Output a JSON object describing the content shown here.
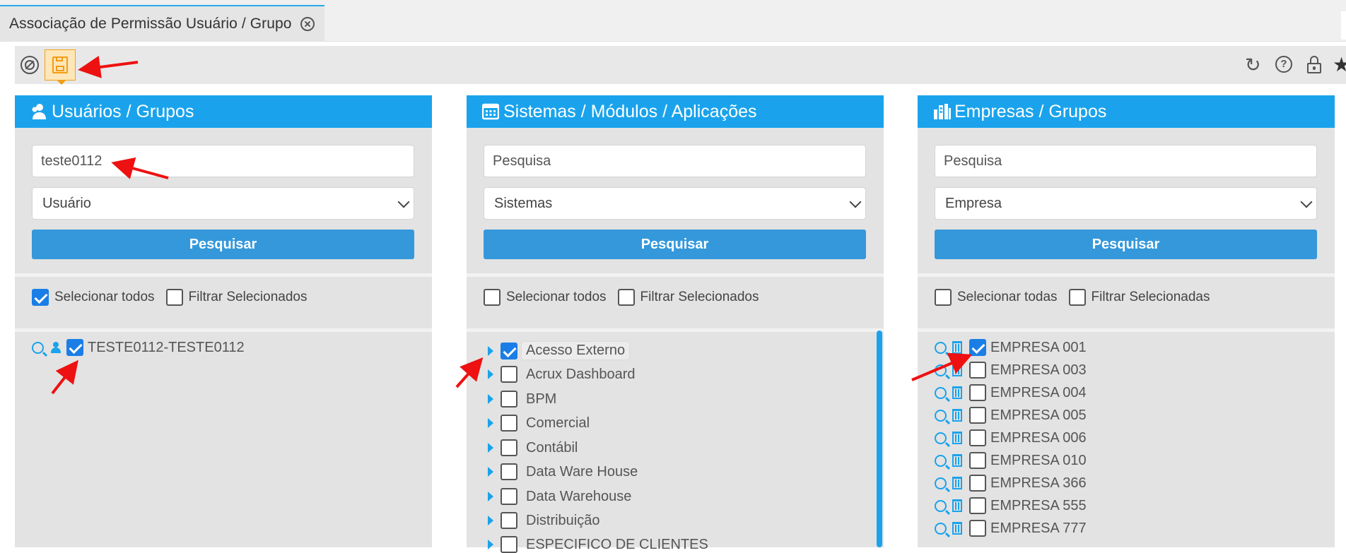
{
  "tab": {
    "title": "Associação de Permissão Usuário / Grupo"
  },
  "toolbar": {
    "left_icons": [
      "cancel-icon",
      "save-icon"
    ],
    "right_icons": [
      "refresh-icon",
      "help-icon",
      "lock-icon",
      "star-icon"
    ]
  },
  "panels": [
    {
      "title": "Usuários / Grupos",
      "icon": "user-group-icon",
      "search_value": "teste0112",
      "search_placeholder": "",
      "select_value": "Usuário",
      "button_label": "Pesquisar",
      "select_all_label": "Selecionar todos",
      "select_all_checked": true,
      "filter_label": "Filtrar Selecionados",
      "filter_checked": false,
      "items": [
        {
          "label": "TESTE0112-TESTE0112",
          "checked": true
        }
      ]
    },
    {
      "title": "Sistemas / Módulos / Aplicações",
      "icon": "calendar-grid-icon",
      "search_value": "",
      "search_placeholder": "Pesquisa",
      "select_value": "Sistemas",
      "button_label": "Pesquisar",
      "select_all_label": "Selecionar todos",
      "select_all_checked": false,
      "filter_label": "Filtrar Selecionados",
      "filter_checked": false,
      "items": [
        {
          "label": "Acesso Externo",
          "checked": true
        },
        {
          "label": "Acrux Dashboard",
          "checked": false
        },
        {
          "label": "BPM",
          "checked": false
        },
        {
          "label": "Comercial",
          "checked": false
        },
        {
          "label": "Contábil",
          "checked": false
        },
        {
          "label": "Data Ware House",
          "checked": false
        },
        {
          "label": "Data Warehouse",
          "checked": false
        },
        {
          "label": "Distribuição",
          "checked": false
        },
        {
          "label": "ESPECIFICO DE CLIENTES",
          "checked": false
        }
      ]
    },
    {
      "title": "Empresas / Grupos",
      "icon": "buildings-icon",
      "search_value": "",
      "search_placeholder": "Pesquisa",
      "select_value": "Empresa",
      "button_label": "Pesquisar",
      "select_all_label": "Selecionar todas",
      "select_all_checked": false,
      "filter_label": "Filtrar Selecionadas",
      "filter_checked": false,
      "items": [
        {
          "label": "EMPRESA 001",
          "checked": true
        },
        {
          "label": "EMPRESA 003",
          "checked": false
        },
        {
          "label": "EMPRESA 004",
          "checked": false
        },
        {
          "label": "EMPRESA 005",
          "checked": false
        },
        {
          "label": "EMPRESA 006",
          "checked": false
        },
        {
          "label": "EMPRESA 010",
          "checked": false
        },
        {
          "label": "EMPRESA 366",
          "checked": false
        },
        {
          "label": "EMPRESA 555",
          "checked": false
        },
        {
          "label": "EMPRESA 777",
          "checked": false
        }
      ]
    }
  ],
  "colors": {
    "accent": "#1aa3ec",
    "button": "#3498db",
    "checkbox_checked": "#1a7ee6",
    "annotation_arrow": "#ee1111",
    "save_highlight": "#f39c12"
  }
}
